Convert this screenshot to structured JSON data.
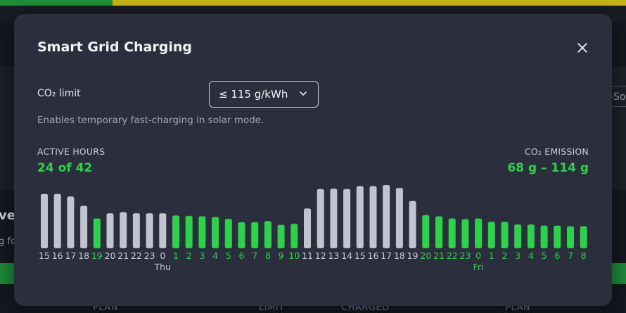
{
  "background": {
    "right_pill_text": "-So",
    "left_heading_text": "ve",
    "left_body_text": "g fo",
    "footer_labels": [
      "PLAN",
      "LIMIT",
      "CHARGED",
      "PLAN"
    ]
  },
  "modal": {
    "title": "Smart Grid Charging",
    "co2_limit_label": "CO₂ limit",
    "co2_limit_value": "≤ 115 g/kWh",
    "hint": "Enables temporary fast-charging in solar mode.",
    "active_hours_label": "ACTIVE HOURS",
    "active_hours_value": "24 of 42",
    "emission_label": "CO₂ EMISSION",
    "emission_value": "68 g – 114 g"
  },
  "colors": {
    "active": "#2bd24a",
    "inactive": "#c2c3d0",
    "modal_bg": "#2b2e3d"
  },
  "chart_data": {
    "type": "bar",
    "hours": [
      "15",
      "16",
      "17",
      "18",
      "19",
      "20",
      "21",
      "22",
      "23",
      "0",
      "1",
      "2",
      "3",
      "4",
      "5",
      "6",
      "7",
      "8",
      "9",
      "10",
      "11",
      "12",
      "13",
      "14",
      "15",
      "16",
      "17",
      "18",
      "19",
      "20",
      "21",
      "22",
      "23",
      "0",
      "1",
      "2",
      "3",
      "4",
      "5",
      "6",
      "7",
      "8"
    ],
    "active": [
      false,
      false,
      false,
      false,
      true,
      false,
      false,
      false,
      false,
      false,
      true,
      true,
      true,
      true,
      true,
      true,
      true,
      true,
      true,
      true,
      false,
      false,
      false,
      false,
      false,
      false,
      false,
      false,
      false,
      true,
      true,
      true,
      true,
      true,
      true,
      true,
      true,
      true,
      true,
      true,
      true,
      true
    ],
    "values": [
      146,
      146,
      139,
      114,
      80,
      94,
      97,
      94,
      94,
      94,
      88,
      87,
      86,
      84,
      79,
      70,
      70,
      73,
      63,
      66,
      107,
      159,
      160,
      159,
      167,
      167,
      170,
      162,
      127,
      89,
      86,
      80,
      78,
      80,
      71,
      71,
      64,
      64,
      61,
      61,
      59,
      59
    ],
    "day_labels": [
      {
        "index": 9,
        "label": "Thu",
        "active": false
      },
      {
        "index": 33,
        "label": "Fri",
        "active": true
      }
    ]
  }
}
